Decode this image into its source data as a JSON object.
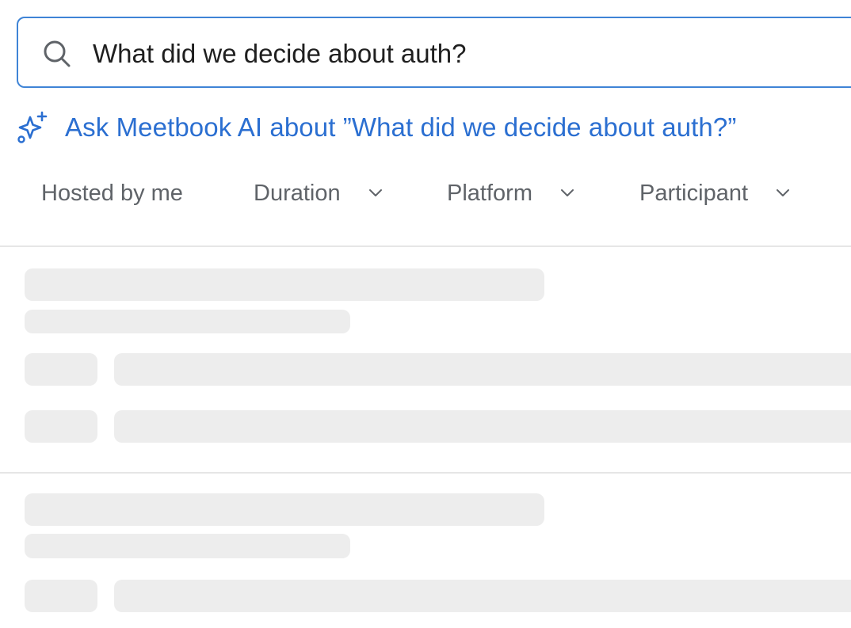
{
  "search": {
    "value": "What did we decide about auth?"
  },
  "ai_prompt": {
    "label": "Ask Meetbook AI about ”What did we decide about auth?”"
  },
  "filters": [
    {
      "label": "Hosted by me",
      "has_dropdown": false
    },
    {
      "label": "Duration",
      "has_dropdown": true
    },
    {
      "label": "Platform",
      "has_dropdown": true
    },
    {
      "label": "Participant",
      "has_dropdown": true
    }
  ],
  "results": {
    "state": "loading"
  },
  "colors": {
    "accent": "#2b6fd1",
    "search_border": "#3f84d6",
    "skeleton": "#ededed",
    "divider": "#e6e6e6",
    "filter_text": "#5f6368"
  },
  "icons": {
    "search": "search-icon",
    "ai": "sparkle-icon",
    "dropdown": "chevron-down-icon"
  }
}
